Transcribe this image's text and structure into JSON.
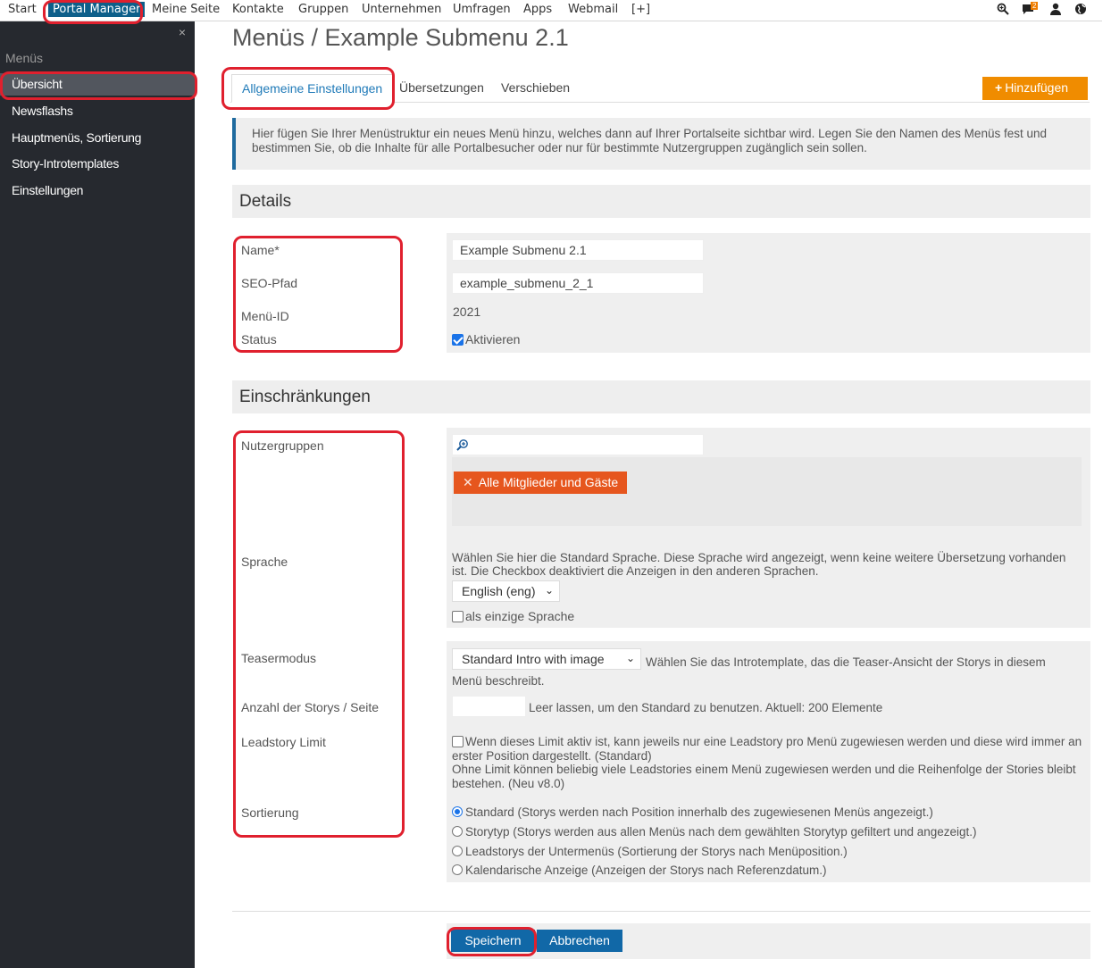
{
  "topnav": {
    "items": [
      "Start",
      "Portal Manager",
      "Meine Seite",
      "Kontakte",
      "Gruppen",
      "Unternehmen",
      "Umfragen",
      "Apps",
      "Webmail",
      "[+]"
    ],
    "notification_count": "2"
  },
  "sidebar": {
    "close": "×",
    "title": "Menüs",
    "items": [
      "Übersicht",
      "Newsflashs",
      "Hauptmenüs, Sortierung",
      "Story-Introtemplates",
      "Einstellungen"
    ]
  },
  "page": {
    "title": "Menüs / Example Submenu 2.1",
    "tabs": [
      "Allgemeine Einstellungen",
      "Übersetzungen",
      "Verschieben"
    ],
    "add_button": "Hinzufügen",
    "info_text": "Hier fügen Sie Ihrer Menüstruktur ein neues Menü hinzu, welches dann auf Ihrer Portalseite sichtbar wird. Legen Sie den Namen des Menüs fest und bestimmen Sie, ob die Inhalte für alle Portalbesucher oder nur für bestimmte Nutzergruppen zugänglich sein sollen."
  },
  "details": {
    "heading": "Details",
    "labels": {
      "name": "Name*",
      "seo": "SEO-Pfad",
      "menu_id": "Menü-ID",
      "status": "Status"
    },
    "name_value": "Example Submenu 2.1",
    "seo_value": "example_submenu_2_1",
    "menu_id_value": "2021",
    "status_checkbox": "Aktivieren"
  },
  "restrictions": {
    "heading": "Einschränkungen",
    "labels": {
      "groups": "Nutzergruppen",
      "language": "Sprache",
      "teaser": "Teasermodus",
      "count": "Anzahl der Storys / Seite",
      "leadstory": "Leadstory Limit",
      "sorting": "Sortierung"
    },
    "group_tag": "Alle Mitglieder und Gäste",
    "language_help": "Wählen Sie hier die Standard Sprache. Diese Sprache wird angezeigt, wenn keine weitere Übersetzung vorhanden ist. Die Checkbox deaktiviert die Anzeigen in den anderen Sprachen.",
    "language_select": "English (eng)",
    "language_only": "als einzige Sprache",
    "teaser_select": "Standard Intro with image",
    "teaser_help": "Wählen Sie das Introtemplate, das die Teaser-Ansicht der Storys in diesem Menü beschreibt.",
    "count_value": "",
    "count_help": "Leer lassen, um den Standard zu benutzen. Aktuell: 200 Elemente",
    "leadstory_text": "Wenn dieses Limit aktiv ist, kann jeweils nur eine Leadstory pro Menü zugewiesen werden und diese wird immer an erster Position dargestellt. (Standard)",
    "leadstory_text2": "Ohne Limit können beliebig viele Leadstories einem Menü zugewiesen werden und die Reihenfolge der Stories bleibt bestehen. (Neu v8.0)",
    "sorting_options": [
      "Standard (Storys werden nach Position innerhalb des zugewiesenen Menüs angezeigt.)",
      "Storytyp (Storys werden aus allen Menüs nach dem gewählten Storytyp gefiltert und angezeigt.)",
      "Leadstorys der Untermenüs (Sortierung der Storys nach Menüposition.)",
      "Kalendarische Anzeige (Anzeigen der Storys nach Referenzdatum.)"
    ]
  },
  "footer": {
    "save": "Speichern",
    "cancel": "Abbrechen"
  },
  "colors": {
    "accent": "#1168a7",
    "add_button": "#f08c00",
    "tag": "#e6561e",
    "sidebar": "#26292f",
    "highlight": "#e0202e"
  }
}
